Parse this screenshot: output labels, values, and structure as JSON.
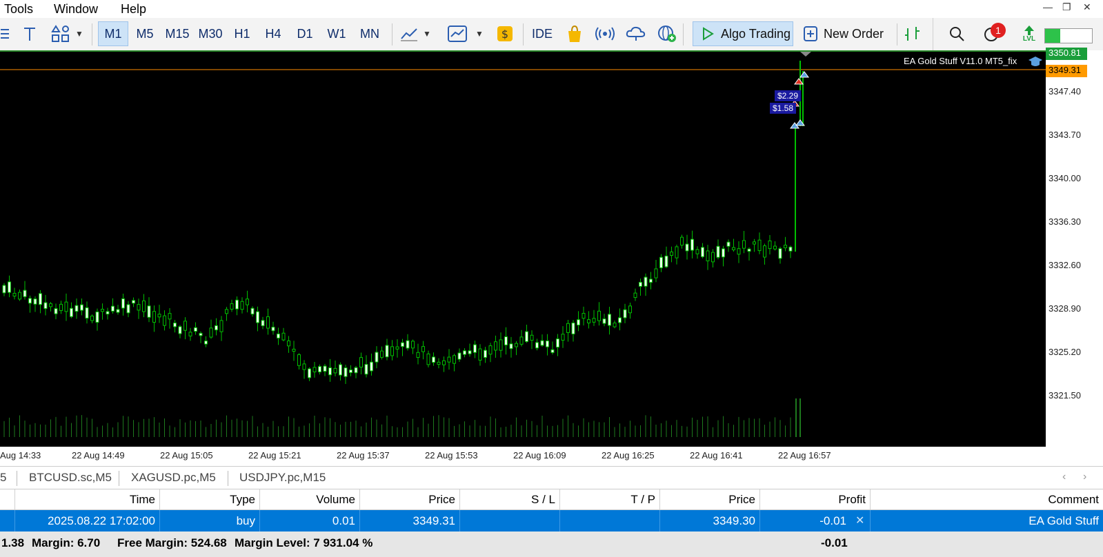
{
  "menu": {
    "items": [
      "Tools",
      "Window",
      "Help"
    ]
  },
  "toolbar": {
    "timeframes": [
      "M1",
      "M5",
      "M15",
      "M30",
      "H1",
      "H4",
      "D1",
      "W1",
      "MN"
    ],
    "active_timeframe": "M1",
    "ide_label": "IDE",
    "algo_trading_label": "Algo Trading",
    "new_order_label": "New Order",
    "lvl_label": "LVL",
    "notification_count": "1"
  },
  "chart": {
    "ea_label": "EA Gold Stuff V11.0 MT5_fix",
    "price_tags": {
      "top": "3350.81",
      "current": "3349.31"
    },
    "trade_labels": [
      "$2.29",
      "$1.58"
    ],
    "price_levels": [
      "3347.40",
      "3343.70",
      "3340.00",
      "3336.30",
      "3332.60",
      "3328.90",
      "3325.20",
      "3321.50"
    ],
    "time_labels": [
      "Aug 14:33",
      "22 Aug 14:49",
      "22 Aug 15:05",
      "22 Aug 15:21",
      "22 Aug 15:37",
      "22 Aug 15:53",
      "22 Aug 16:09",
      "22 Aug 16:25",
      "22 Aug 16:41",
      "22 Aug 16:57"
    ],
    "colors": {
      "background": "#000000",
      "candle": "#00c000",
      "bid_line": "#ff8c00"
    }
  },
  "tabs": {
    "items": [
      "5",
      "BTCUSD.sc,M5",
      "XAGUSD.pc,M5",
      "USDJPY.pc,M15"
    ]
  },
  "table": {
    "headers": [
      "Time",
      "Type",
      "Volume",
      "Price",
      "S / L",
      "T / P",
      "Price",
      "Profit",
      "Comment"
    ],
    "row": [
      "2025.08.22 17:02:00",
      "buy",
      "0.01",
      "3349.31",
      "",
      "",
      "3349.30",
      "-0.01",
      "EA Gold Stuff"
    ]
  },
  "summary": {
    "balance_fragment": "1.38",
    "margin": "Margin: 6.70",
    "free_margin": "Free Margin: 524.68",
    "margin_level": "Margin Level: 7 931.04 %",
    "profit_total": "-0.01"
  }
}
